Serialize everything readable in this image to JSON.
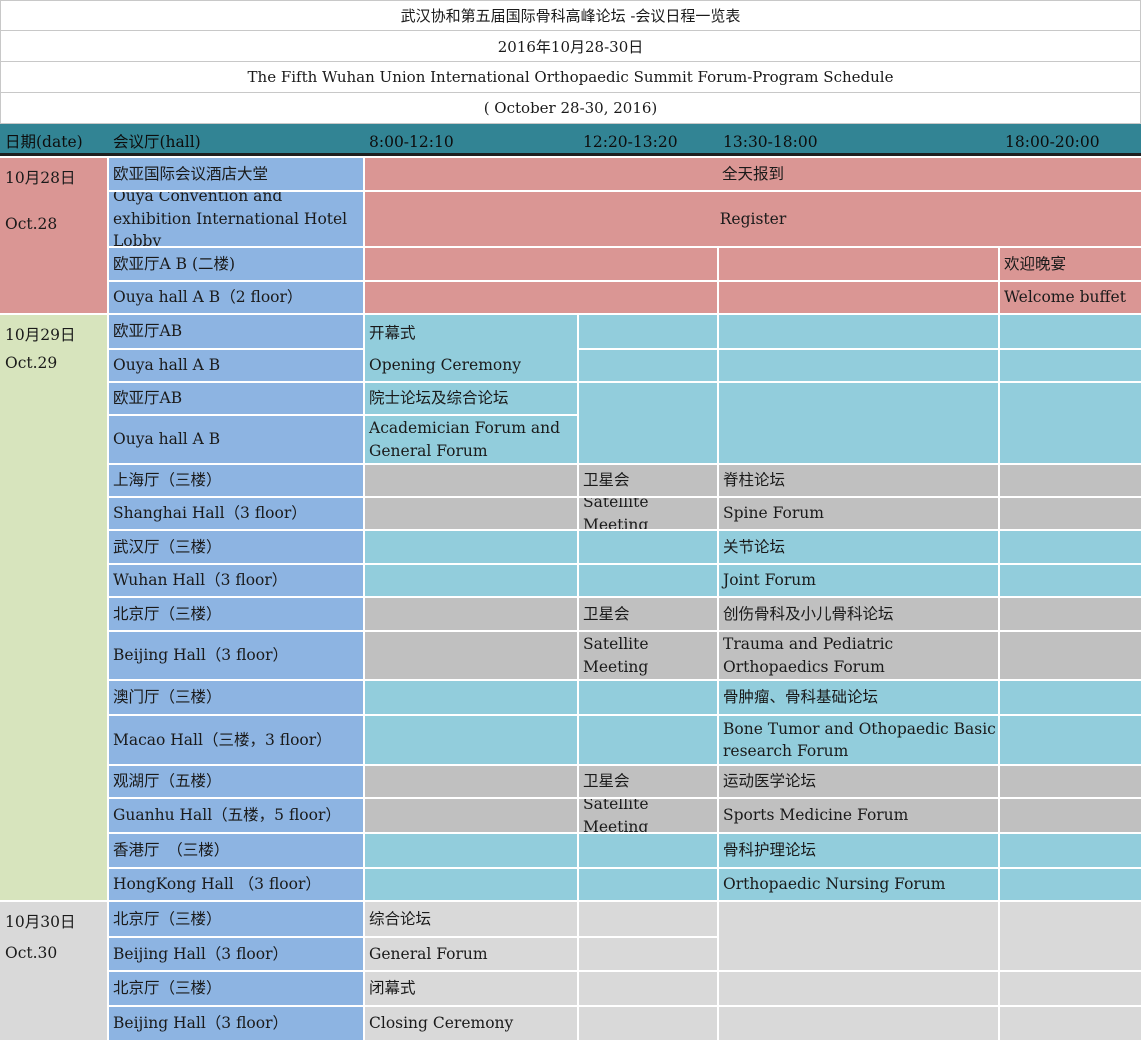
{
  "titles": [
    "武汉协和第五届国际骨科高峰论坛 -会议日程一览表",
    "2016年10月28-30日",
    "The Fifth Wuhan Union International Orthopaedic Summit Forum-Program Schedule",
    "( October 28-30, 2016)"
  ],
  "header": {
    "date": "日期(date)",
    "hall": "会议厅(hall)",
    "slot1": "8:00-12:10",
    "slot2": "12:20-13:20",
    "slot3": "13:30-18:00",
    "slot4": "18:00-20:00"
  },
  "dates": [
    {
      "cn": "10月28日",
      "en": "Oct.28"
    },
    {
      "cn": "10月29日",
      "en": "Oct.29"
    },
    {
      "cn": "10月30日",
      "en": "Oct.30"
    }
  ],
  "halls": {
    "ouya_lobby_cn": "欧亚国际会议酒店大堂",
    "ouya_lobby_en": "Ouya Convention and exhibition International Hotel Lobby",
    "ouya_ab2_cn": "欧亚厅A B (二楼)",
    "ouya_ab2_en": "Ouya hall A B（2 floor）",
    "ouya_ab_cn_1": "欧亚厅AB",
    "ouya_ab_en_1": "Ouya hall A B",
    "ouya_ab_cn_2": "欧亚厅AB",
    "ouya_ab_en_2": "Ouya hall A B",
    "shanghai_cn": "上海厅（三楼）",
    "shanghai_en": "Shanghai Hall（3 floor）",
    "wuhan_cn": "武汉厅（三楼）",
    "wuhan_en": " Wuhan Hall（3 floor）",
    "beijing_cn_1": "北京厅（三楼）",
    "beijing_en_1": "Beijing Hall（3 floor）",
    "macao_cn": "澳门厅（三楼）",
    "macao_en": "Macao Hall（三楼，3 floor）",
    "guanhu_cn": "观湖厅（五楼）",
    "guanhu_en": " Guanhu Hall（五楼，5 floor）",
    "hongkong_cn": "香港厅　（三楼）",
    "hongkong_en": " HongKong Hall （3 floor）",
    "beijing_cn_2": "北京厅（三楼）",
    "beijing_en_2": "Beijing Hall（3 floor）",
    "beijing_cn_3": "北京厅（三楼）",
    "beijing_en_3": "Beijing Hall（3 floor）"
  },
  "events": {
    "register_cn": "全天报到",
    "register_en": "Register",
    "welcome_cn": "欢迎晚宴",
    "welcome_en": "Welcome buffet",
    "opening_cn": "开幕式",
    "opening_en": "Opening Ceremony",
    "academician_cn": "院士论坛及综合论坛",
    "academician_en": "Academician Forum and General Forum",
    "satellite_cn_1": "卫星会",
    "satellite_en_1": "Satellite Meeting",
    "spine_cn": "脊柱论坛",
    "spine_en": "Spine Forum",
    "joint_cn": "关节论坛",
    "joint_en": "Joint Forum",
    "satellite_cn_2": "卫星会",
    "satellite_en_2": "Satellite Meeting",
    "trauma_cn": "创伤骨科及小儿骨科论坛",
    "trauma_en": "Trauma and Pediatric Orthopaedics Forum",
    "tumor_cn": "骨肿瘤、骨科基础论坛",
    "tumor_en": "Bone Tumor and Othopaedic Basic research Forum",
    "satellite_cn_3": "卫星会",
    "satellite_en_3": "Satellite Meeting",
    "sports_cn": "运动医学论坛",
    "sports_en": "Sports Medicine Forum",
    "nursing_cn": " 骨科护理论坛",
    "nursing_en": "Orthopaedic Nursing Forum",
    "general_cn": "综合论坛",
    "general_en": "General Forum",
    "closing_cn": "闭幕式",
    "closing_en": "Closing Ceremony"
  }
}
